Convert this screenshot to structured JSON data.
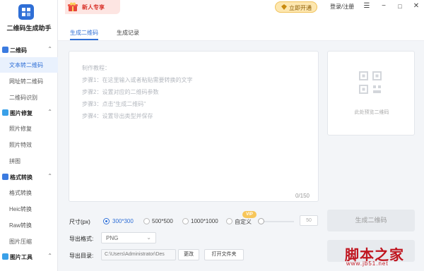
{
  "app": {
    "title": "二维码生成助手"
  },
  "topbar": {
    "promo": "新人专享",
    "vip_button": "立即开通",
    "login": "登录/注册",
    "menu_icon": "hamburger-menu-icon",
    "minimize_icon": "minimize-icon",
    "maximize_icon": "maximize-icon",
    "close_icon": "close-icon"
  },
  "sidebar": {
    "sections": [
      {
        "label": "二维码",
        "items": [
          "文本转二维码",
          "网址转二维码",
          "二维码识别"
        ]
      },
      {
        "label": "图片修复",
        "items": [
          "照片修复",
          "照片特效",
          "拼图"
        ]
      },
      {
        "label": "格式转换",
        "items": [
          "格式转换",
          "Heic转换",
          "Raw转换",
          "图片压缩"
        ]
      },
      {
        "label": "图片工具",
        "items": []
      }
    ],
    "active_item": "文本转二维码"
  },
  "tabs": [
    {
      "label": "生成二维码",
      "active": true
    },
    {
      "label": "生成记录",
      "active": false
    }
  ],
  "editor": {
    "hints": [
      "制作教程：",
      "步骤1：在这里输入或者粘贴需要转换的文字",
      "步骤2：设置对应的二维码参数",
      "步骤3：点击\"生成二维码\"",
      "步骤4：设置导出类型并保存"
    ],
    "counter": "0/150"
  },
  "preview": {
    "label": "此处预览二维码",
    "icon": "qr-code-icon"
  },
  "generate_button": "生成二维码",
  "size": {
    "label": "尺寸(px)",
    "options": [
      "300*300",
      "500*500",
      "1000*1000",
      "自定义"
    ],
    "selected": "300*300",
    "vip_badge": "VIP",
    "custom_value": "50"
  },
  "format": {
    "label": "导出格式:",
    "value": "PNG"
  },
  "export": {
    "label": "导出目录:",
    "path": "C:\\Users\\Administrator\\Des",
    "change_button": "更改",
    "open_button": "打开文件夹"
  },
  "watermark": {
    "text": "脚本之家",
    "url": "www.jb51.net"
  },
  "colors": {
    "accent": "#2f6fd6",
    "promo": "#d9342b",
    "vip": "#f7c65a",
    "watermark": "#c0151f"
  }
}
